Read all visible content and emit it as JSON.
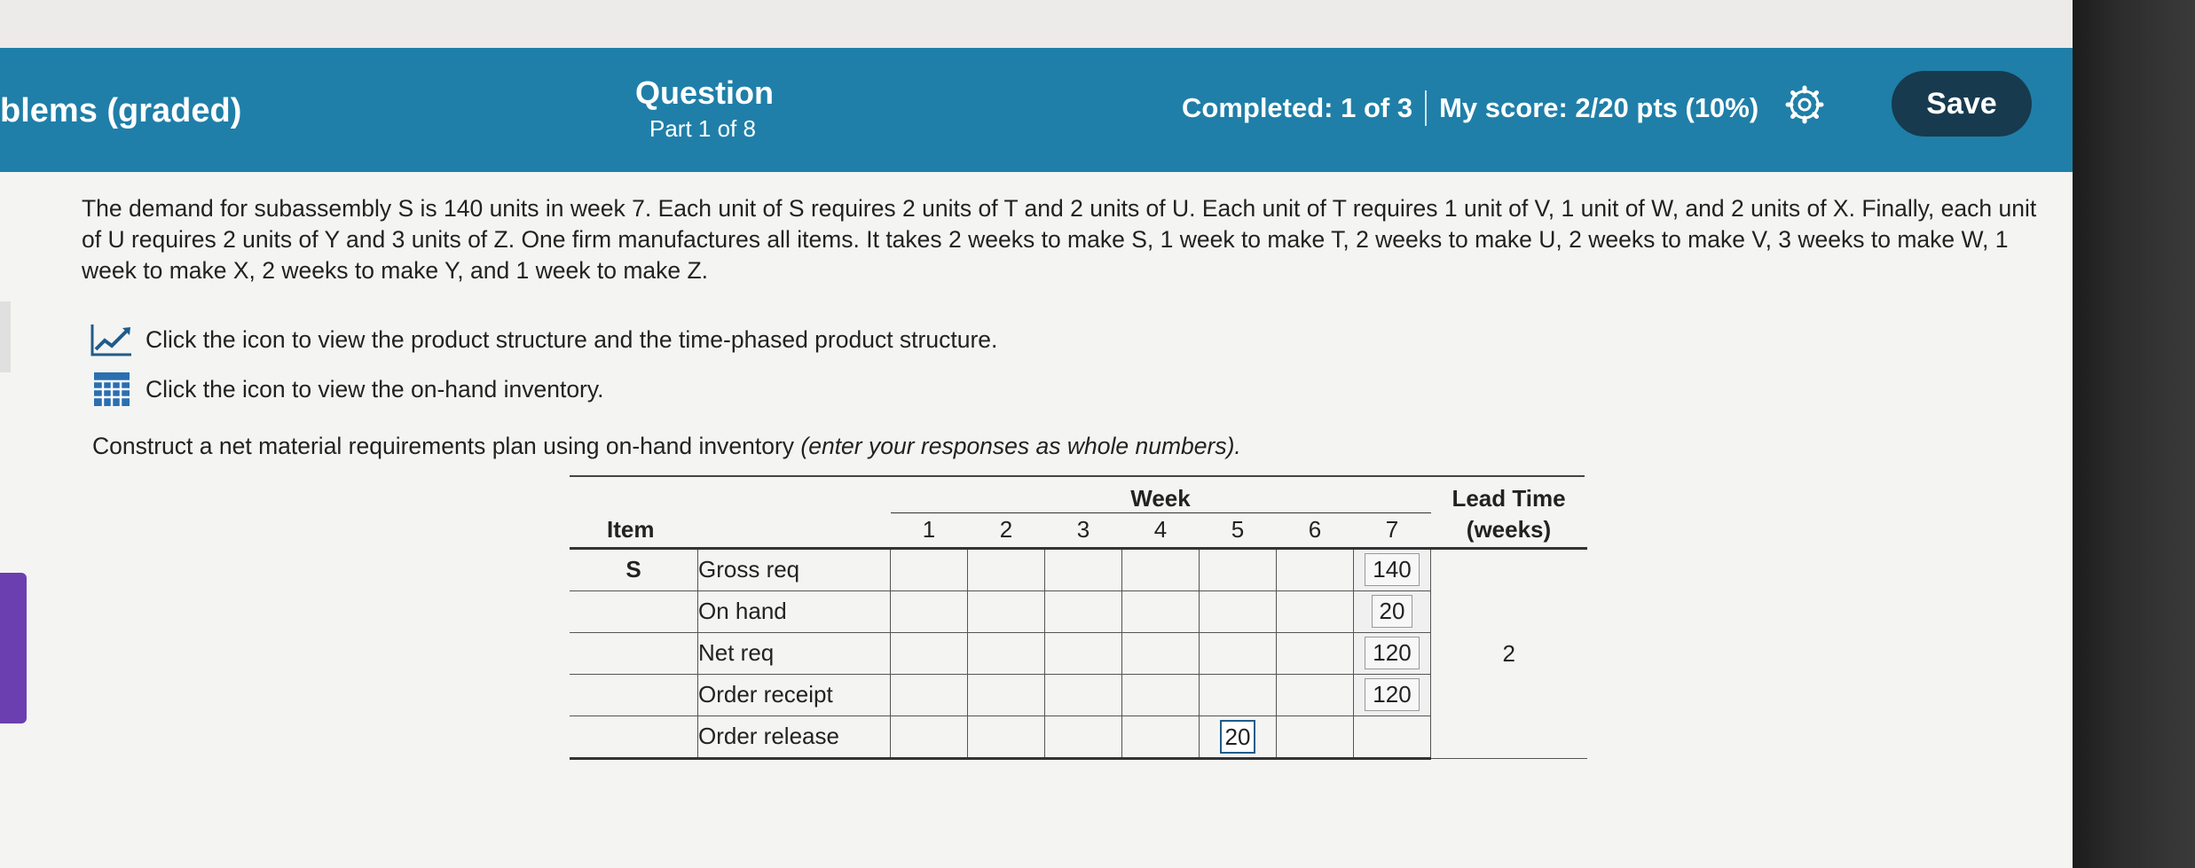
{
  "header": {
    "course_title": "blems (graded)",
    "question_label": "Question",
    "part_label": "Part 1 of 8",
    "completed": "Completed: 1 of 3",
    "score": "My score: 2/20 pts (10%)",
    "save_label": "Save"
  },
  "problem": {
    "text": "The demand for subassembly S is 140 units in week 7. Each unit of S requires 2 units of T and 2 units of U. Each unit of T requires 1 unit of V, 1 unit of W, and 2 units of X. Finally, each unit of U requires 2 units of Y and 3 units of Z. One firm manufactures all items. It takes 2 weeks to make S, 1 week to make T, 2 weeks to make U, 2 weeks to make V, 3 weeks to make W, 1 week to make X, 2 weeks to make Y, and 1 week to make Z.",
    "link1": "Click the icon to view the product structure and the time-phased product structure.",
    "link2": "Click the icon to view the on-hand inventory.",
    "instruction_main": "Construct a net material requirements plan using on-hand inventory ",
    "instruction_note": "(enter your responses as whole numbers)."
  },
  "table": {
    "item_header": "Item",
    "week_header": "Week",
    "lead_time_header": "Lead Time",
    "lead_time_unit": "(weeks)",
    "weeks": [
      "1",
      "2",
      "3",
      "4",
      "5",
      "6",
      "7"
    ],
    "item": "S",
    "lead_time_value": "2",
    "rows": [
      {
        "label": "Gross req",
        "week7": "140"
      },
      {
        "label": "On hand",
        "week7": "20"
      },
      {
        "label": "Net req",
        "week7": "120"
      },
      {
        "label": "Order receipt",
        "week7": "120"
      },
      {
        "label": "Order release",
        "week5_input": "20"
      }
    ]
  },
  "colors": {
    "header_bg": "#1f7fa8",
    "save_bg": "#173a4e",
    "purple_tab": "#6b3fb0"
  },
  "icons": [
    "gear-icon",
    "chart-icon",
    "table-icon"
  ]
}
